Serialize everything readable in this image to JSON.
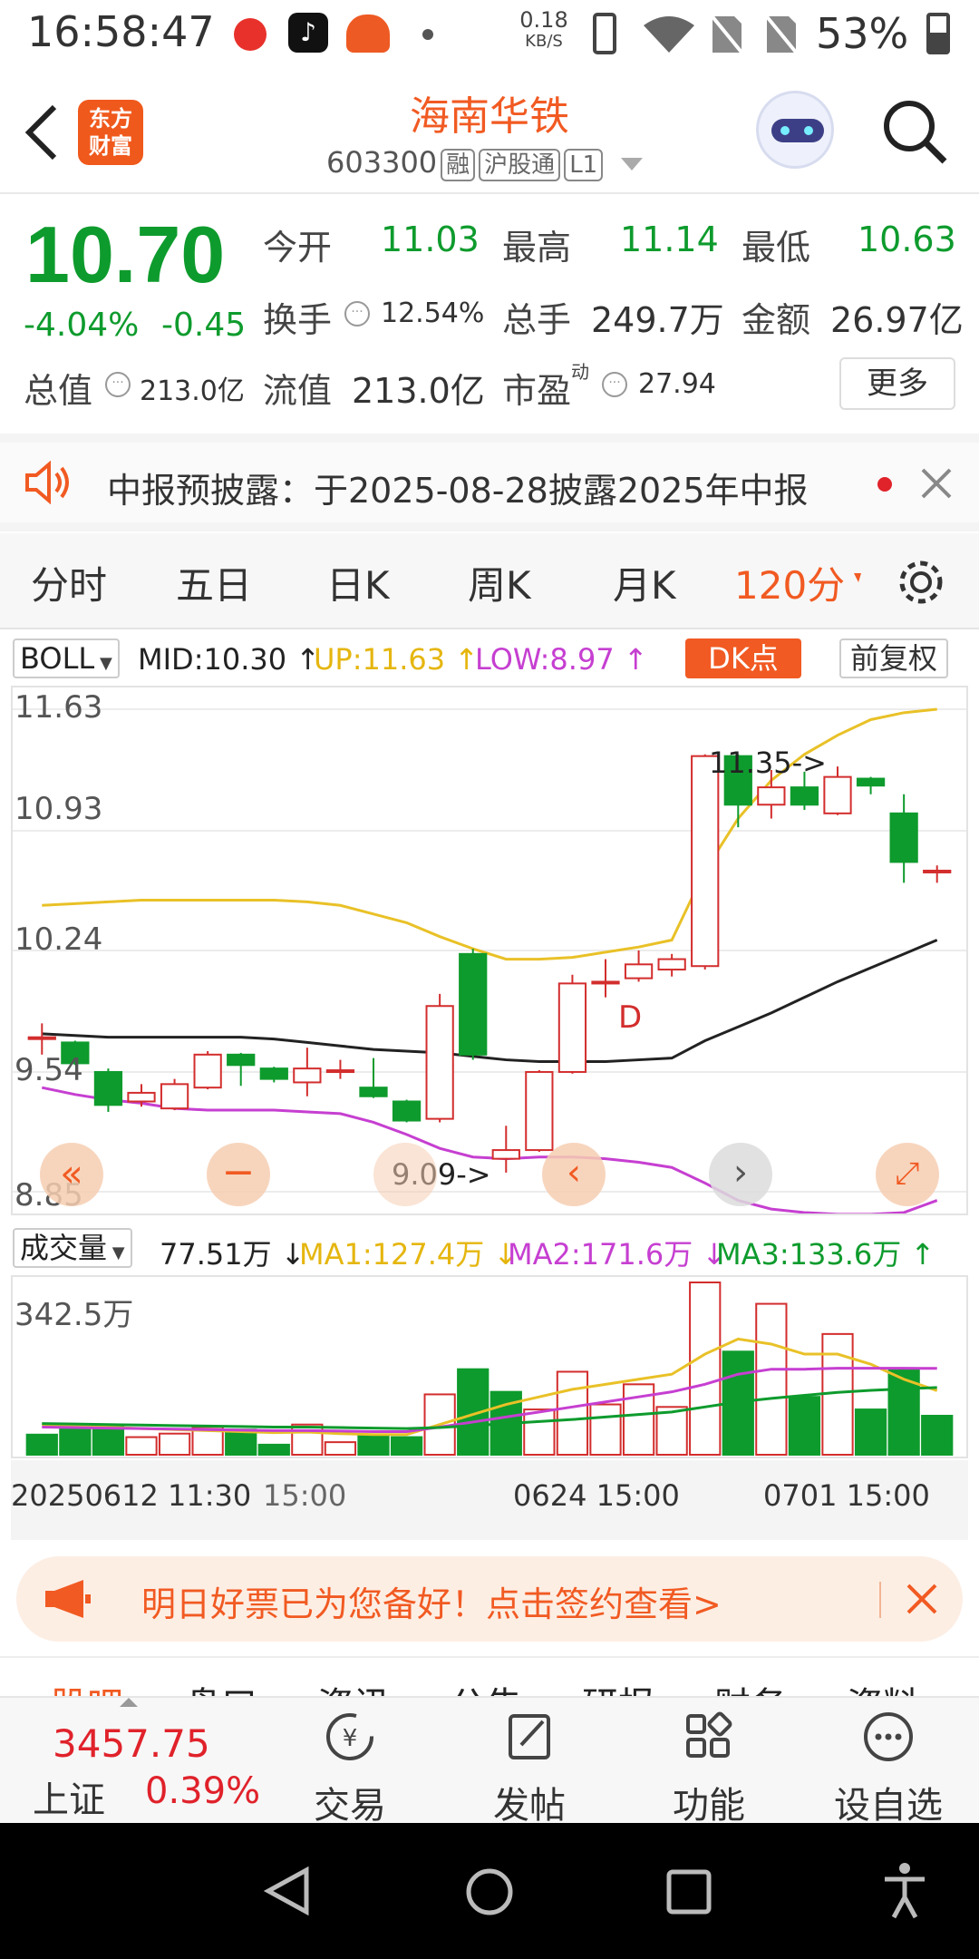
{
  "status_bar": {
    "time": "16:58:47",
    "net_speed_value": "0.18",
    "net_speed_unit": "KB/S",
    "battery": "53%"
  },
  "header": {
    "logo_line1": "东方",
    "logo_line2": "财富",
    "stock_name": "海南华铁",
    "stock_code": "603300",
    "tag_margin": "融",
    "tag_connect": "沪股通",
    "tag_level": "L1"
  },
  "quote": {
    "price": "10.70",
    "change_pct": "-4.04%",
    "change": "-0.45",
    "open_label": "今开",
    "open": "11.03",
    "high_label": "最高",
    "high": "11.14",
    "low_label": "最低",
    "low": "10.63",
    "turnover_label": "换手",
    "turnover": "12.54%",
    "volume_label": "总手",
    "volume": "249.7万",
    "amount_label": "金额",
    "amount": "26.97亿",
    "total_cap_label": "总值",
    "total_cap": "213.0亿",
    "float_cap_label": "流值",
    "float_cap": "213.0亿",
    "pe_label": "市盈",
    "pe_sup": "动",
    "pe": "27.94",
    "more_button": "更多"
  },
  "notice": {
    "text": "中报预披露：于2025-08-28披露2025年中报"
  },
  "tabs": [
    "分时",
    "五日",
    "日K",
    "周K",
    "月K",
    "120分"
  ],
  "active_tab": "120分",
  "indicator_bar": {
    "name": "BOLL",
    "mid": "MID:10.30",
    "up": "UP:11.63",
    "low": "LOW:8.97",
    "dk_button": "DK点",
    "adjust": "前复权"
  },
  "volume_bar": {
    "name": "成交量",
    "vol": "77.51万",
    "ma1": "MA1:127.4万",
    "ma2": "MA2:171.6万",
    "ma3": "MA3:133.6万",
    "max_label": "342.5万"
  },
  "chart_data": [
    {
      "type": "candlestick",
      "y_ticks": [
        "11.63",
        "10.93",
        "10.24",
        "9.54",
        "8.85"
      ],
      "ylim": [
        8.85,
        11.63
      ],
      "annotations": [
        "11.35->",
        "9.09->",
        "D"
      ],
      "candles": [
        {
          "o": 9.74,
          "c": 9.74,
          "h": 9.82,
          "l": 9.64
        },
        {
          "o": 9.71,
          "c": 9.59,
          "h": 9.72,
          "l": 9.58
        },
        {
          "o": 9.54,
          "c": 9.35,
          "h": 9.56,
          "l": 9.31
        },
        {
          "o": 9.37,
          "c": 9.42,
          "h": 9.47,
          "l": 9.34
        },
        {
          "o": 9.33,
          "c": 9.47,
          "h": 9.5,
          "l": 9.32
        },
        {
          "o": 9.45,
          "c": 9.64,
          "h": 9.66,
          "l": 9.44
        },
        {
          "o": 9.64,
          "c": 9.58,
          "h": 9.65,
          "l": 9.46
        },
        {
          "o": 9.56,
          "c": 9.5,
          "h": 9.57,
          "l": 9.48
        },
        {
          "o": 9.48,
          "c": 9.56,
          "h": 9.68,
          "l": 9.4
        },
        {
          "o": 9.55,
          "c": 9.55,
          "h": 9.61,
          "l": 9.5
        },
        {
          "o": 9.45,
          "c": 9.4,
          "h": 9.62,
          "l": 9.39
        },
        {
          "o": 9.37,
          "c": 9.26,
          "h": 9.38,
          "l": 9.25
        },
        {
          "o": 9.27,
          "c": 9.92,
          "h": 9.99,
          "l": 9.25
        },
        {
          "o": 10.22,
          "c": 9.64,
          "h": 10.25,
          "l": 9.61
        },
        {
          "o": 9.04,
          "c": 9.09,
          "h": 9.23,
          "l": 8.96
        },
        {
          "o": 9.09,
          "c": 9.54,
          "h": 9.55,
          "l": 9.08
        },
        {
          "o": 9.54,
          "c": 10.05,
          "h": 10.1,
          "l": 9.53
        },
        {
          "o": 10.05,
          "c": 10.06,
          "h": 10.19,
          "l": 9.97
        },
        {
          "o": 10.08,
          "c": 10.16,
          "h": 10.24,
          "l": 10.06
        },
        {
          "o": 10.13,
          "c": 10.19,
          "h": 10.22,
          "l": 10.09
        },
        {
          "o": 10.15,
          "c": 11.36,
          "h": 11.37,
          "l": 10.13
        },
        {
          "o": 11.36,
          "c": 11.08,
          "h": 11.37,
          "l": 10.95
        },
        {
          "o": 11.08,
          "c": 11.18,
          "h": 11.28,
          "l": 11.0
        },
        {
          "o": 11.18,
          "c": 11.08,
          "h": 11.27,
          "l": 11.05
        },
        {
          "o": 11.03,
          "c": 11.24,
          "h": 11.3,
          "l": 11.02
        },
        {
          "o": 11.23,
          "c": 11.19,
          "h": 11.24,
          "l": 11.14
        },
        {
          "o": 11.03,
          "c": 10.75,
          "h": 11.14,
          "l": 10.63
        },
        {
          "o": 10.7,
          "c": 10.7,
          "h": 10.73,
          "l": 10.63
        }
      ],
      "boll_mid": [
        9.76,
        9.75,
        9.74,
        9.74,
        9.74,
        9.74,
        9.74,
        9.73,
        9.71,
        9.69,
        9.67,
        9.66,
        9.65,
        9.63,
        9.61,
        9.6,
        9.6,
        9.6,
        9.61,
        9.62,
        9.72,
        9.8,
        9.88,
        9.97,
        10.06,
        10.14,
        10.22,
        10.3
      ],
      "boll_up": [
        10.5,
        10.51,
        10.52,
        10.53,
        10.53,
        10.53,
        10.53,
        10.53,
        10.52,
        10.5,
        10.45,
        10.4,
        10.32,
        10.25,
        10.19,
        10.19,
        10.2,
        10.23,
        10.26,
        10.3,
        10.7,
        11.0,
        11.22,
        11.37,
        11.48,
        11.57,
        11.61,
        11.63
      ],
      "boll_low": [
        9.45,
        9.41,
        9.38,
        9.36,
        9.33,
        9.32,
        9.32,
        9.32,
        9.31,
        9.3,
        9.25,
        9.18,
        9.1,
        9.05,
        9.04,
        9.05,
        9.05,
        9.04,
        9.02,
        8.99,
        8.9,
        8.8,
        8.75,
        8.73,
        8.72,
        8.72,
        8.73,
        8.8
      ],
      "colors": {
        "up": "#d32d2d",
        "down": "#0e9b2d",
        "mid": "#222222",
        "upper": "#e9c127",
        "lower": "#c63fd1"
      }
    },
    {
      "type": "bar",
      "title": "成交量",
      "ylim": [
        0,
        342.5
      ],
      "values": [
        40,
        60,
        60,
        35,
        42,
        55,
        50,
        20,
        60,
        25,
        40,
        35,
        120,
        170,
        125,
        90,
        165,
        100,
        140,
        95,
        342.5,
        205,
        300,
        115,
        240,
        90,
        170,
        77.51
      ],
      "up": [
        false,
        false,
        false,
        true,
        true,
        true,
        false,
        false,
        true,
        true,
        false,
        false,
        true,
        false,
        false,
        true,
        true,
        true,
        true,
        true,
        true,
        false,
        true,
        false,
        true,
        false,
        false,
        false
      ],
      "ma1": [
        60,
        58,
        55,
        52,
        50,
        48,
        46,
        44,
        45,
        42,
        40,
        40,
        60,
        80,
        100,
        115,
        130,
        140,
        150,
        160,
        200,
        230,
        220,
        200,
        200,
        180,
        150,
        127.4
      ],
      "ma2": [
        55,
        54,
        53,
        52,
        51,
        50,
        49,
        48,
        48,
        47,
        46,
        46,
        55,
        65,
        75,
        85,
        95,
        105,
        115,
        125,
        140,
        160,
        170,
        170,
        172,
        172,
        172,
        171.6
      ],
      "ma3": [
        62,
        61,
        60,
        59,
        58,
        57,
        56,
        55,
        55,
        54,
        53,
        52,
        54,
        58,
        62,
        66,
        70,
        75,
        80,
        85,
        95,
        105,
        112,
        118,
        124,
        128,
        131,
        133.6
      ]
    }
  ],
  "time_axis": [
    "20250612 11:30",
    "15:00",
    "0624 15:00",
    "0701 15:00"
  ],
  "promo": {
    "text": "明日好票已为您备好！点击签约查看>"
  },
  "sub_tabs": [
    "股吧",
    "盘口",
    "资讯",
    "公告",
    "研报",
    "财务",
    "资料"
  ],
  "index": {
    "value": "3457.75",
    "name": "上证",
    "change": "0.39%"
  },
  "bottom_nav": [
    "交易",
    "发帖",
    "功能",
    "设自选"
  ]
}
